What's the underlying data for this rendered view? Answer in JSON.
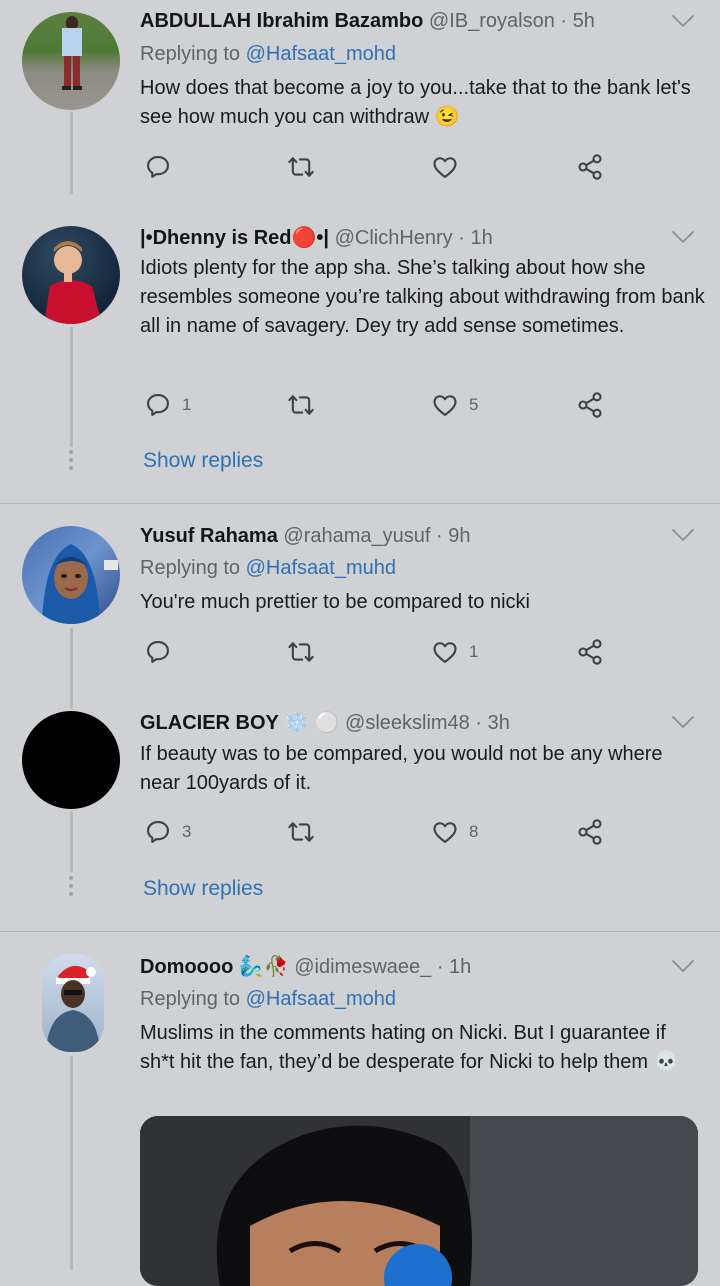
{
  "tweets": [
    {
      "name": "ABDULLAH Ibrahim Bazambo",
      "handle": "@IB_royalson",
      "time": "· 5h",
      "replying_prefix": "Replying to",
      "replying_to": "@Hafsaat_mohd",
      "text": "How does that become a joy to you...take that to the bank let's see how much you can withdraw 😉",
      "replies": "",
      "likes": ""
    },
    {
      "name": "|•Dhenny is Red🔴•|",
      "handle": "@ClichHenry",
      "time": "· 1h",
      "text": "Idiots plenty for the app sha. She’s talking about how she resembles someone you’re talking about withdrawing from bank all in name of savagery. Dey try add sense sometimes.",
      "replies": "1",
      "likes": "5",
      "show_replies": "Show replies"
    },
    {
      "name": "Yusuf Rahama",
      "handle": "@rahama_yusuf",
      "time": "· 9h",
      "replying_prefix": "Replying to",
      "replying_to": "@Hafsaat_muhd",
      "text": "You're much prettier to be compared to nicki",
      "replies": "",
      "likes": "1"
    },
    {
      "name": "GLACIER BOY ❄️ ⚪",
      "handle": "@sleekslim48",
      "time": "· 3h",
      "text": "If beauty was to be compared, you would not be any where near 100yards of it.",
      "replies": "3",
      "likes": "8",
      "show_replies": "Show replies"
    },
    {
      "name": "Domoooo 🧞‍♂️🥀",
      "handle": "@idimeswaee_",
      "time": "· 1h",
      "replying_prefix": "Replying to",
      "replying_to": "@Hafsaat_mohd",
      "text": "Muslims in the comments hating on Nicki. But I guarantee if sh*t hit the fan, they’d be desperate for Nicki to help them 💀"
    }
  ],
  "icons": [
    "reply-icon",
    "retweet-icon",
    "like-icon",
    "share-icon",
    "chevron-down-icon"
  ],
  "colors": {
    "background": "#cfd1d4",
    "link": "#2f71b3",
    "secondary_text": "#5f6469"
  }
}
